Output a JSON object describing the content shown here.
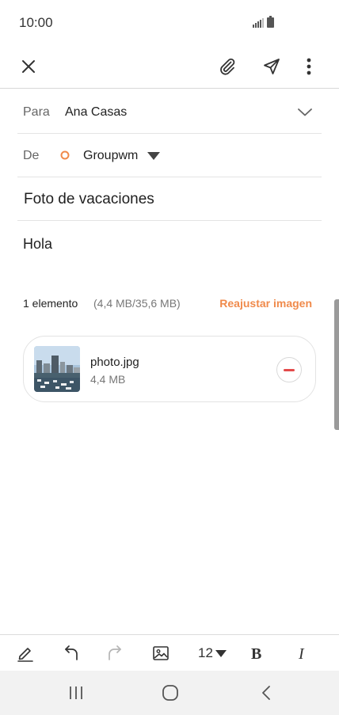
{
  "status": {
    "time": "10:00"
  },
  "compose": {
    "to_label": "Para",
    "to_value": "Ana Casas",
    "from_label": "De",
    "from_value": "Groupwm",
    "subject": "Foto de vacaciones",
    "body": "Hola"
  },
  "attachments": {
    "count_label": "1 elemento",
    "size_label": "(4,4 MB/35,6 MB)",
    "resize_label": "Reajustar imagen",
    "items": [
      {
        "name": "photo.jpg",
        "size": "4,4 MB"
      }
    ]
  },
  "toolbar": {
    "font_size": "12"
  },
  "colors": {
    "accent": "#f08a4b",
    "remove": "#e34a4a"
  }
}
